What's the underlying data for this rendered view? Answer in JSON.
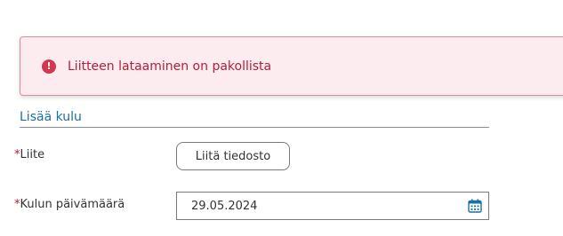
{
  "alert": {
    "icon": "error-icon",
    "icon_glyph": "!",
    "message": "Liitteen lataaminen on pakollista"
  },
  "section": {
    "title": "Lisää kulu"
  },
  "form": {
    "required_marker": "*",
    "attachment": {
      "label": "Liite",
      "button_label": "Liitä tiedosto"
    },
    "expense_date": {
      "label": "Kulun päivämäärä",
      "value": "29.05.2024",
      "icon": "calendar-icon"
    }
  },
  "colors": {
    "alert_background": "#fdecef",
    "alert_border": "#e08a9a",
    "alert_text": "#b21f3a",
    "error_icon": "#d3364f",
    "section_title": "#1e6fa0",
    "required_marker": "#c8102e",
    "calendar_icon": "#1e6fa0"
  }
}
